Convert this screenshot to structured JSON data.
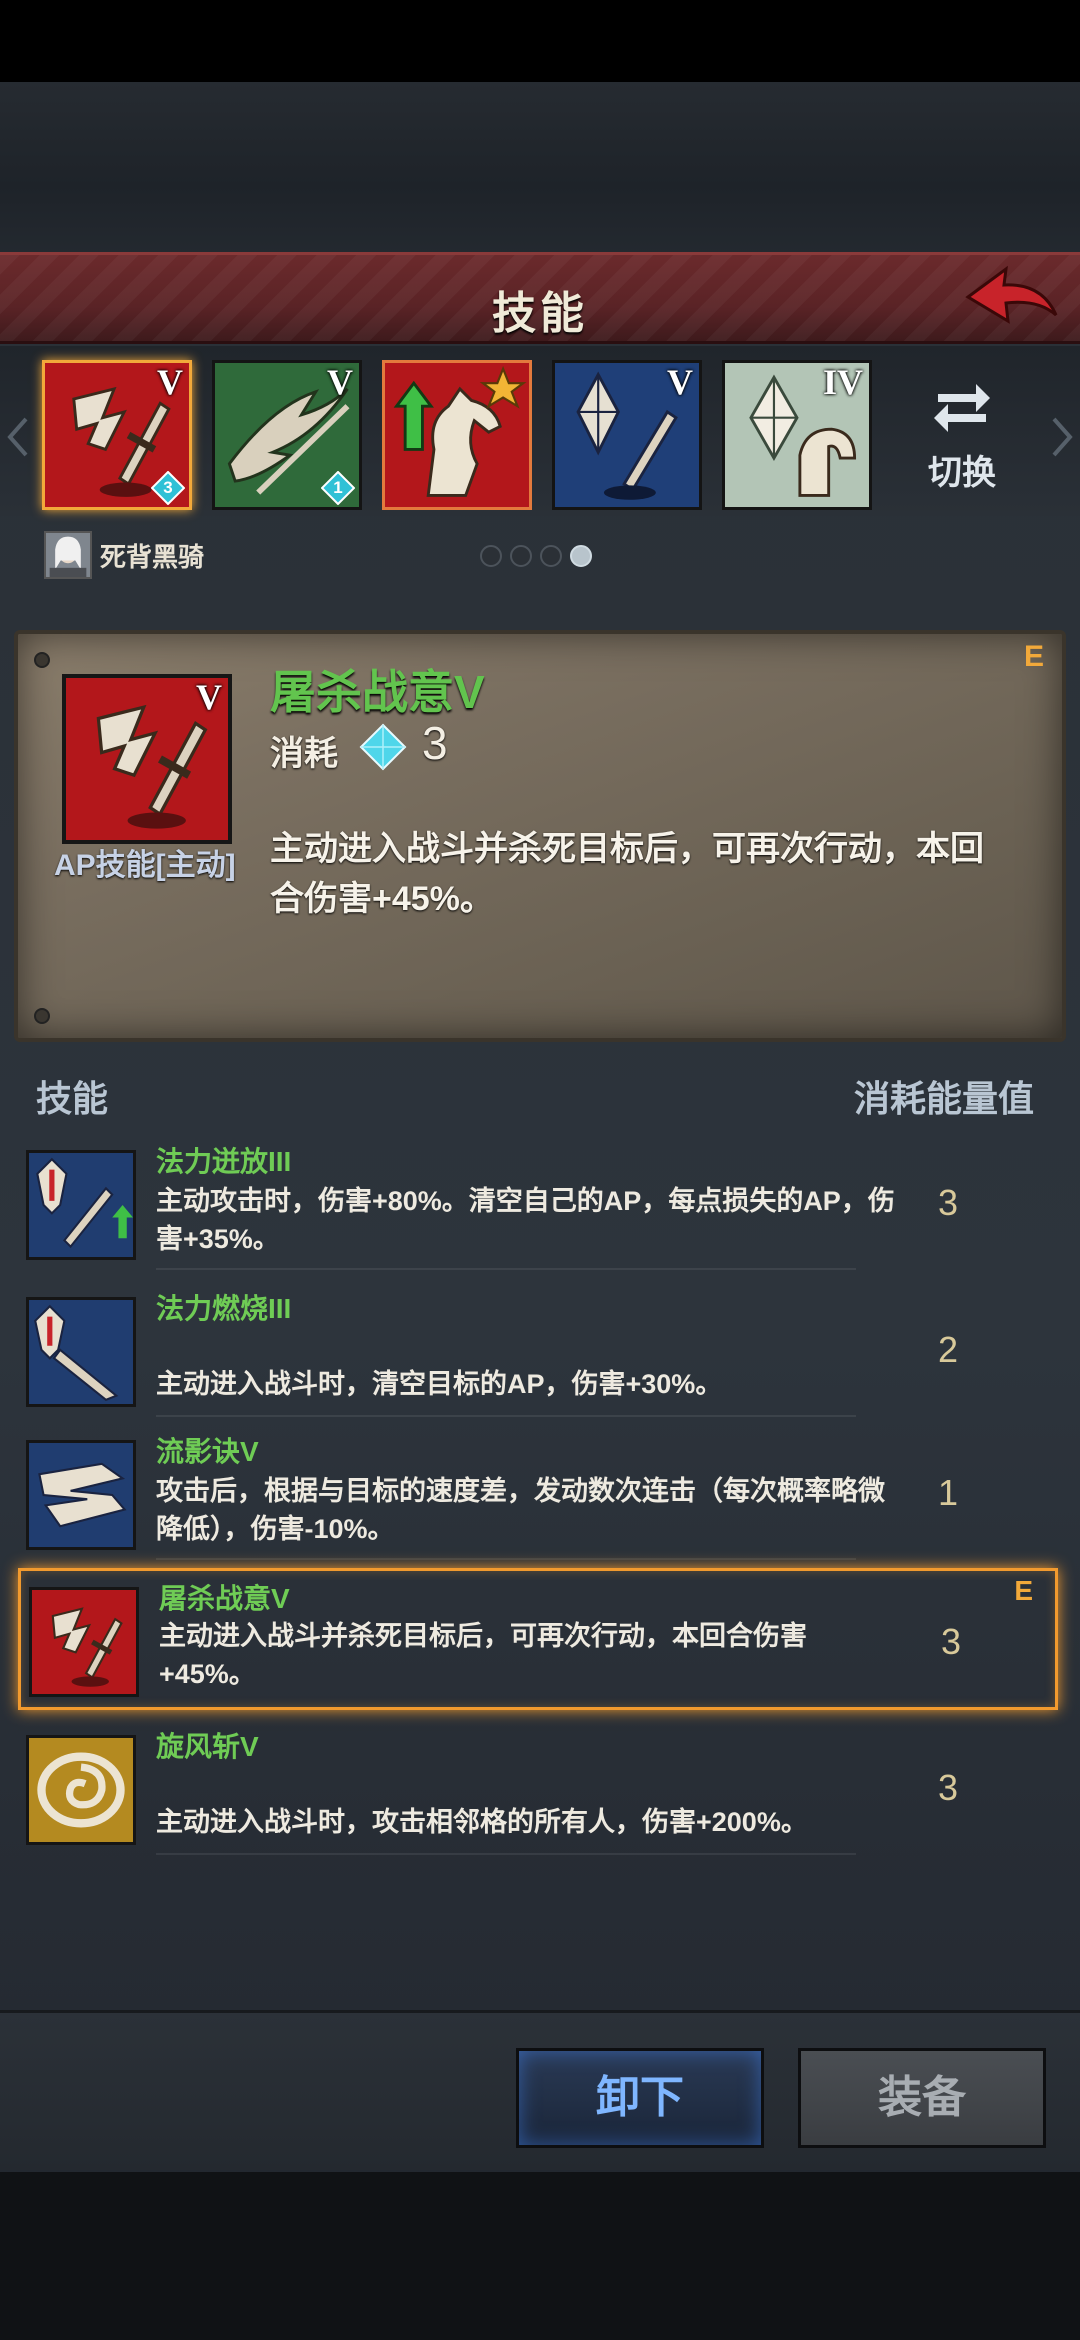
{
  "header": {
    "title": "技能"
  },
  "skill_slots": [
    {
      "rank": "V",
      "badge": "3",
      "badge_color": "#2fc1d6"
    },
    {
      "rank": "V",
      "badge": "1",
      "badge_color": "#2fc1d6"
    },
    {
      "rank": "",
      "badge": "",
      "badge_color": ""
    },
    {
      "rank": "V",
      "badge": "",
      "badge_color": ""
    },
    {
      "rank": "IV",
      "badge": "",
      "badge_color": ""
    }
  ],
  "switch": {
    "label": "切换"
  },
  "character": {
    "name": "死背黑骑"
  },
  "pager": {
    "pages": 4,
    "active": 4
  },
  "detail": {
    "name": "屠杀战意V",
    "rank": "V",
    "cost_label": "消耗",
    "cost": "3",
    "grade": "E",
    "type": "AP技能[主动]",
    "description": "主动进入战斗并杀死目标后，可再次行动，本回合伤害+45%。"
  },
  "list": {
    "header_left": "技能",
    "header_right": "消耗能量值",
    "items": [
      {
        "name": "法力迸放III",
        "desc": "主动攻击时，伤害+80%。清空自己的AP，每点损失的AP，伤害+35%。",
        "cost": "3",
        "grade": ""
      },
      {
        "name": "法力燃烧III",
        "desc": "主动进入战斗时，清空目标的AP，伤害+30%。",
        "cost": "2",
        "grade": ""
      },
      {
        "name": "流影诀V",
        "desc": "攻击后，根据与目标的速度差，发动数次连击（每次概率略微降低），伤害-10%。",
        "cost": "1",
        "grade": ""
      },
      {
        "name": "屠杀战意V",
        "desc": "主动进入战斗并杀死目标后，可再次行动，本回合伤害+45%。",
        "cost": "3",
        "grade": "E"
      },
      {
        "name": "旋风斩V",
        "desc": "主动进入战斗时，攻击相邻格的所有人，伤害+200%。",
        "cost": "3",
        "grade": ""
      }
    ]
  },
  "buttons": {
    "unequip": "卸下",
    "equip": "装备"
  },
  "colors": {
    "skill_name": "#6fcc55",
    "accent": "#f2a93a",
    "header_red": "#5a2326"
  }
}
